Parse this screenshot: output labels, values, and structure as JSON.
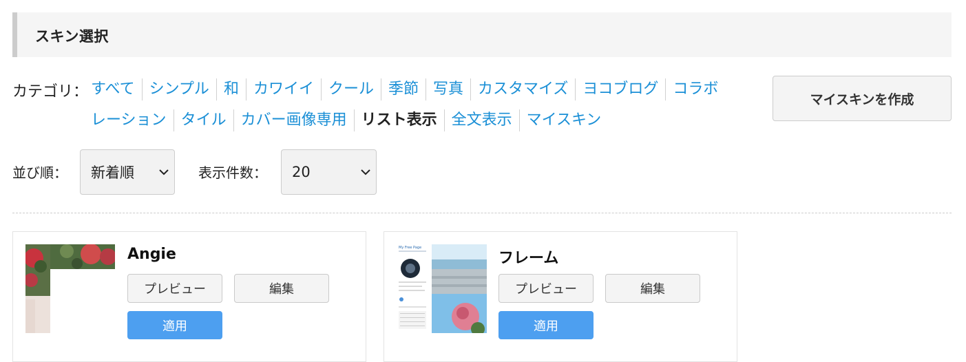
{
  "header": {
    "title": "スキン選択"
  },
  "category": {
    "label": "カテゴリ：",
    "line1": [
      "すべて",
      "シンプル",
      "和",
      "カワイイ",
      "クール",
      "季節",
      "写真",
      "カスタマイズ",
      "ヨコブログ",
      "コラボ"
    ],
    "line2": [
      "レーション",
      "タイル",
      "カバー画像専用",
      "リスト表示",
      "全文表示",
      "マイスキン"
    ],
    "active": "リスト表示"
  },
  "myskin_button": "マイスキンを作成",
  "sort": {
    "label": "並び順：",
    "value": "新着順"
  },
  "count": {
    "label": "表示件数：",
    "value": "20"
  },
  "colors": {
    "link": "#1a8fd6",
    "apply": "#4d9ff0",
    "header_bg": "#f5f5f5"
  },
  "skins": [
    {
      "name": "Angie",
      "preview_label": "プレビュー",
      "edit_label": "編集",
      "apply_label": "適用"
    },
    {
      "name": "フレーム",
      "preview_label": "プレビュー",
      "edit_label": "編集",
      "apply_label": "適用",
      "thumb_text": {
        "blog_title": "My Free Page"
      }
    }
  ]
}
